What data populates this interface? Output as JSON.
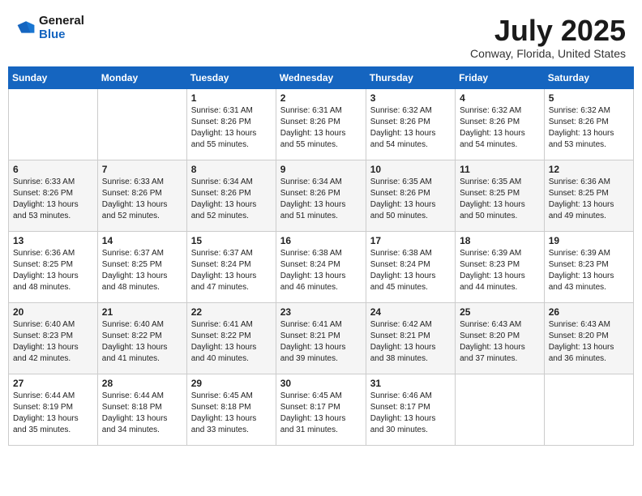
{
  "header": {
    "logo_general": "General",
    "logo_blue": "Blue",
    "month_title": "July 2025",
    "location": "Conway, Florida, United States"
  },
  "weekdays": [
    "Sunday",
    "Monday",
    "Tuesday",
    "Wednesday",
    "Thursday",
    "Friday",
    "Saturday"
  ],
  "weeks": [
    [
      {
        "day": "",
        "info": ""
      },
      {
        "day": "",
        "info": ""
      },
      {
        "day": "1",
        "info": "Sunrise: 6:31 AM\nSunset: 8:26 PM\nDaylight: 13 hours and 55 minutes."
      },
      {
        "day": "2",
        "info": "Sunrise: 6:31 AM\nSunset: 8:26 PM\nDaylight: 13 hours and 55 minutes."
      },
      {
        "day": "3",
        "info": "Sunrise: 6:32 AM\nSunset: 8:26 PM\nDaylight: 13 hours and 54 minutes."
      },
      {
        "day": "4",
        "info": "Sunrise: 6:32 AM\nSunset: 8:26 PM\nDaylight: 13 hours and 54 minutes."
      },
      {
        "day": "5",
        "info": "Sunrise: 6:32 AM\nSunset: 8:26 PM\nDaylight: 13 hours and 53 minutes."
      }
    ],
    [
      {
        "day": "6",
        "info": "Sunrise: 6:33 AM\nSunset: 8:26 PM\nDaylight: 13 hours and 53 minutes."
      },
      {
        "day": "7",
        "info": "Sunrise: 6:33 AM\nSunset: 8:26 PM\nDaylight: 13 hours and 52 minutes."
      },
      {
        "day": "8",
        "info": "Sunrise: 6:34 AM\nSunset: 8:26 PM\nDaylight: 13 hours and 52 minutes."
      },
      {
        "day": "9",
        "info": "Sunrise: 6:34 AM\nSunset: 8:26 PM\nDaylight: 13 hours and 51 minutes."
      },
      {
        "day": "10",
        "info": "Sunrise: 6:35 AM\nSunset: 8:26 PM\nDaylight: 13 hours and 50 minutes."
      },
      {
        "day": "11",
        "info": "Sunrise: 6:35 AM\nSunset: 8:25 PM\nDaylight: 13 hours and 50 minutes."
      },
      {
        "day": "12",
        "info": "Sunrise: 6:36 AM\nSunset: 8:25 PM\nDaylight: 13 hours and 49 minutes."
      }
    ],
    [
      {
        "day": "13",
        "info": "Sunrise: 6:36 AM\nSunset: 8:25 PM\nDaylight: 13 hours and 48 minutes."
      },
      {
        "day": "14",
        "info": "Sunrise: 6:37 AM\nSunset: 8:25 PM\nDaylight: 13 hours and 48 minutes."
      },
      {
        "day": "15",
        "info": "Sunrise: 6:37 AM\nSunset: 8:24 PM\nDaylight: 13 hours and 47 minutes."
      },
      {
        "day": "16",
        "info": "Sunrise: 6:38 AM\nSunset: 8:24 PM\nDaylight: 13 hours and 46 minutes."
      },
      {
        "day": "17",
        "info": "Sunrise: 6:38 AM\nSunset: 8:24 PM\nDaylight: 13 hours and 45 minutes."
      },
      {
        "day": "18",
        "info": "Sunrise: 6:39 AM\nSunset: 8:23 PM\nDaylight: 13 hours and 44 minutes."
      },
      {
        "day": "19",
        "info": "Sunrise: 6:39 AM\nSunset: 8:23 PM\nDaylight: 13 hours and 43 minutes."
      }
    ],
    [
      {
        "day": "20",
        "info": "Sunrise: 6:40 AM\nSunset: 8:23 PM\nDaylight: 13 hours and 42 minutes."
      },
      {
        "day": "21",
        "info": "Sunrise: 6:40 AM\nSunset: 8:22 PM\nDaylight: 13 hours and 41 minutes."
      },
      {
        "day": "22",
        "info": "Sunrise: 6:41 AM\nSunset: 8:22 PM\nDaylight: 13 hours and 40 minutes."
      },
      {
        "day": "23",
        "info": "Sunrise: 6:41 AM\nSunset: 8:21 PM\nDaylight: 13 hours and 39 minutes."
      },
      {
        "day": "24",
        "info": "Sunrise: 6:42 AM\nSunset: 8:21 PM\nDaylight: 13 hours and 38 minutes."
      },
      {
        "day": "25",
        "info": "Sunrise: 6:43 AM\nSunset: 8:20 PM\nDaylight: 13 hours and 37 minutes."
      },
      {
        "day": "26",
        "info": "Sunrise: 6:43 AM\nSunset: 8:20 PM\nDaylight: 13 hours and 36 minutes."
      }
    ],
    [
      {
        "day": "27",
        "info": "Sunrise: 6:44 AM\nSunset: 8:19 PM\nDaylight: 13 hours and 35 minutes."
      },
      {
        "day": "28",
        "info": "Sunrise: 6:44 AM\nSunset: 8:18 PM\nDaylight: 13 hours and 34 minutes."
      },
      {
        "day": "29",
        "info": "Sunrise: 6:45 AM\nSunset: 8:18 PM\nDaylight: 13 hours and 33 minutes."
      },
      {
        "day": "30",
        "info": "Sunrise: 6:45 AM\nSunset: 8:17 PM\nDaylight: 13 hours and 31 minutes."
      },
      {
        "day": "31",
        "info": "Sunrise: 6:46 AM\nSunset: 8:17 PM\nDaylight: 13 hours and 30 minutes."
      },
      {
        "day": "",
        "info": ""
      },
      {
        "day": "",
        "info": ""
      }
    ]
  ]
}
